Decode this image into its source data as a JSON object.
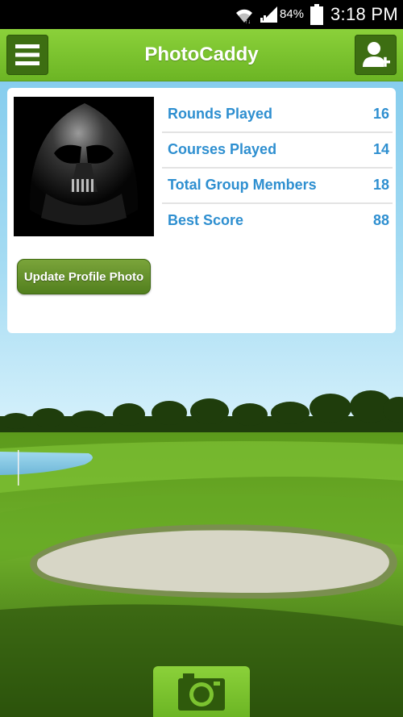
{
  "status_bar": {
    "battery_percent": "84%",
    "time": "3:18 PM",
    "icons": [
      "wifi-icon",
      "signal-icon",
      "battery-icon"
    ]
  },
  "header": {
    "title": "PhotoCaddy",
    "menu_icon": "hamburger-menu-icon",
    "add_user_icon": "add-user-icon"
  },
  "profile": {
    "avatar_description": "profile-photo",
    "stats": [
      {
        "label": "Rounds Played",
        "value": "16"
      },
      {
        "label": "Courses Played",
        "value": "14"
      },
      {
        "label": "Total Group Members",
        "value": "18"
      },
      {
        "label": "Best Score",
        "value": "88"
      }
    ],
    "update_button_label": "Update Profile Photo"
  },
  "footer": {
    "camera_icon": "camera-icon"
  },
  "colors": {
    "accent_green": "#6cb524",
    "dark_green": "#3d6e12",
    "stat_blue": "#2e8fd0"
  }
}
